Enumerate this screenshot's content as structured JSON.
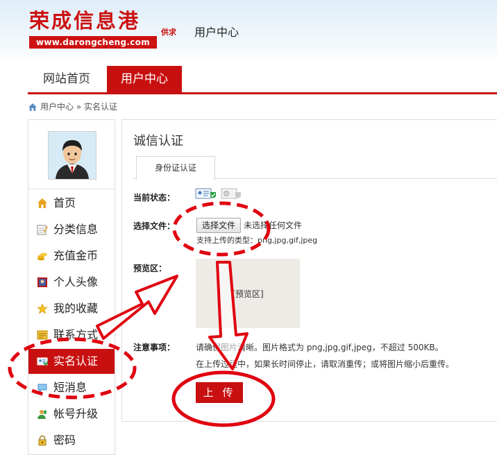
{
  "header": {
    "logo_cn": "荣成信息港",
    "logo_url": "www.darongcheng.com",
    "logo_supply": "供求",
    "title": "用户中心"
  },
  "nav": {
    "home": "网站首页",
    "user_center": "用户中心"
  },
  "breadcrumb": {
    "text": "用户中心 » 实名认证"
  },
  "sidebar": {
    "items": [
      {
        "label": "首页",
        "icon": "house-icon"
      },
      {
        "label": "分类信息",
        "icon": "edit-note-icon"
      },
      {
        "label": "充值金币",
        "icon": "coins-icon"
      },
      {
        "label": "个人头像",
        "icon": "portrait-icon"
      },
      {
        "label": "我的收藏",
        "icon": "star-icon"
      },
      {
        "label": "联系方式",
        "icon": "contact-card-icon"
      },
      {
        "label": "实名认证",
        "icon": "id-card-icon",
        "active": true
      },
      {
        "label": "短消息",
        "icon": "chat-bubble-icon"
      },
      {
        "label": "帐号升级",
        "icon": "user-upgrade-icon"
      },
      {
        "label": "密码",
        "icon": "lock-icon"
      }
    ]
  },
  "main": {
    "title": "诚信认证",
    "tab": "身份证认证",
    "status_label": "当前状态：",
    "file_label": "选择文件：",
    "file_button": "选择文件",
    "file_none": "未选择任何文件",
    "file_types": "支持上传的类型：png,jpg,gif,jpeg",
    "preview_label": "预览区：",
    "preview_text": "[预览区]",
    "notes_label": "注意事项：",
    "note1": "请确保图片清晰。图片格式为 png,jpg,gif,jpeg，不超过 500KB。",
    "note2": "在上传过程中，如果长时间停止，请取消重传；或将图片缩小后重传。",
    "upload_button": "上 传"
  },
  "colors": {
    "brand_red": "#c81010",
    "annotation_red": "#e0000f"
  }
}
